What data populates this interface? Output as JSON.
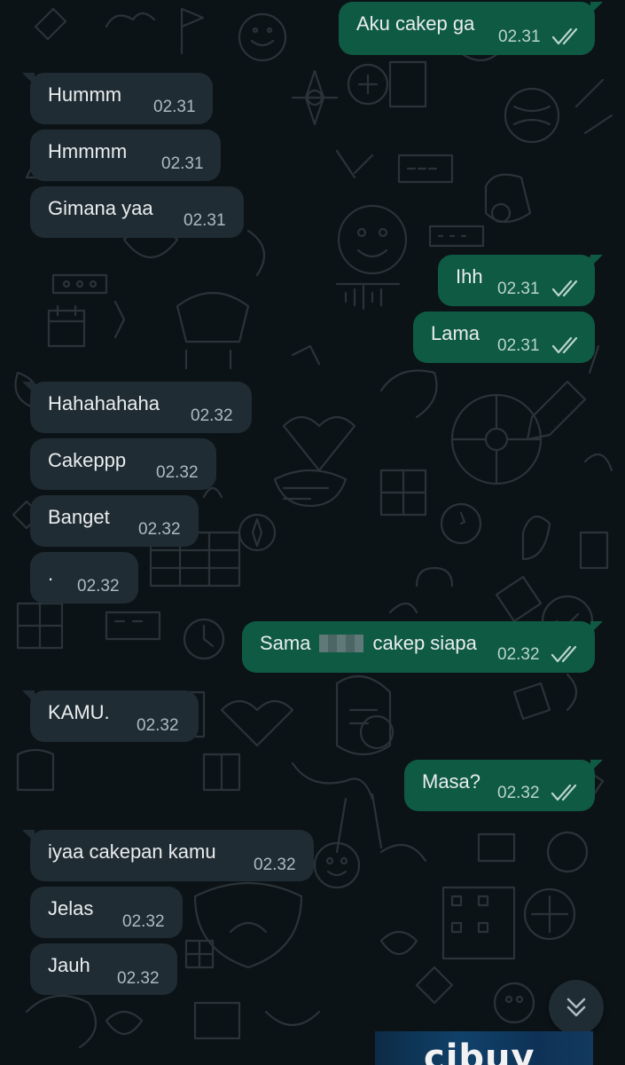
{
  "messages": [
    {
      "dir": "out",
      "text": "Aku cakep ga",
      "time": "02.31",
      "status": "read"
    },
    {
      "dir": "in",
      "text": "Hummm",
      "time": "02.31"
    },
    {
      "dir": "in",
      "text": "Hmmmm",
      "time": "02.31"
    },
    {
      "dir": "in",
      "text": "Gimana yaa",
      "time": "02.31"
    },
    {
      "dir": "out",
      "text": "Ihh",
      "time": "02.31",
      "status": "read"
    },
    {
      "dir": "out",
      "text": "Lama",
      "time": "02.31",
      "status": "read"
    },
    {
      "dir": "in",
      "text": "Hahahahaha",
      "time": "02.32"
    },
    {
      "dir": "in",
      "text": "Cakeppp",
      "time": "02.32"
    },
    {
      "dir": "in",
      "text": "Banget",
      "time": "02.32"
    },
    {
      "dir": "in",
      "text": ".",
      "time": "02.32"
    },
    {
      "dir": "out",
      "text_before": "Sama",
      "text_after": "cakep siapa",
      "redacted": true,
      "time": "02.32",
      "status": "read"
    },
    {
      "dir": "in",
      "text": "KAMU.",
      "time": "02.32"
    },
    {
      "dir": "out",
      "text": "Masa?",
      "time": "02.32",
      "status": "read"
    },
    {
      "dir": "in",
      "text": "iyaa cakepan kamu",
      "time": "02.32"
    },
    {
      "dir": "in",
      "text": "Jelas",
      "time": "02.32"
    },
    {
      "dir": "in",
      "text": "Jauh",
      "time": "02.32"
    }
  ],
  "scroll_button": {
    "icon": "double-chevron-down-icon"
  },
  "sticker": {
    "text": "cibuy"
  },
  "colors": {
    "background": "#0c1317",
    "incoming_bubble": "#202c33",
    "outgoing_bubble": "#0f5a43",
    "read_ticks": "#b9d4cb"
  }
}
